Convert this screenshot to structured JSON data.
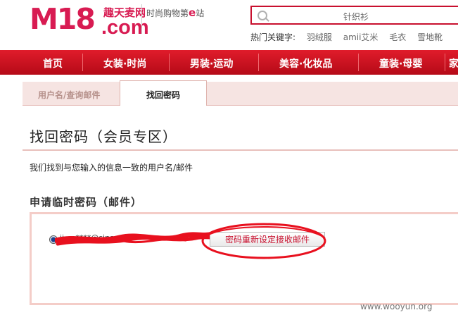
{
  "header": {
    "logo_m18": "M18",
    "logo_cn": "趣天麦网",
    "logo_com": ".com",
    "slogan_before": "时尚购物第",
    "slogan_e": "e",
    "slogan_after": "站",
    "search_value": "针织衫",
    "hot_label": "热门关键字:",
    "hot_keywords": [
      "羽绒服",
      "amii艾米",
      "毛衣",
      "雪地靴"
    ]
  },
  "nav": {
    "items": [
      "首页",
      "女装·时尚",
      "男装·运动",
      "美容·化妆品",
      "童装·母婴",
      "家"
    ]
  },
  "tabs": {
    "inactive": "用户名/查询邮件",
    "active": "找回密码"
  },
  "content": {
    "page_title": "找回密码（会员专区）",
    "info": "我们找到与您输入的信息一致的用户名/邮件",
    "section_title": "申请临时密码（邮件）",
    "email_partial": "ji_m****@sina",
    "reset_button": "密码重新设定接收邮件"
  },
  "watermark": "www.wooyun.org",
  "colors": {
    "brand": "#d81b52",
    "nav_red": "#c8102e",
    "tab_bg": "#f6e4e2",
    "annotation_red": "#e8101e"
  }
}
